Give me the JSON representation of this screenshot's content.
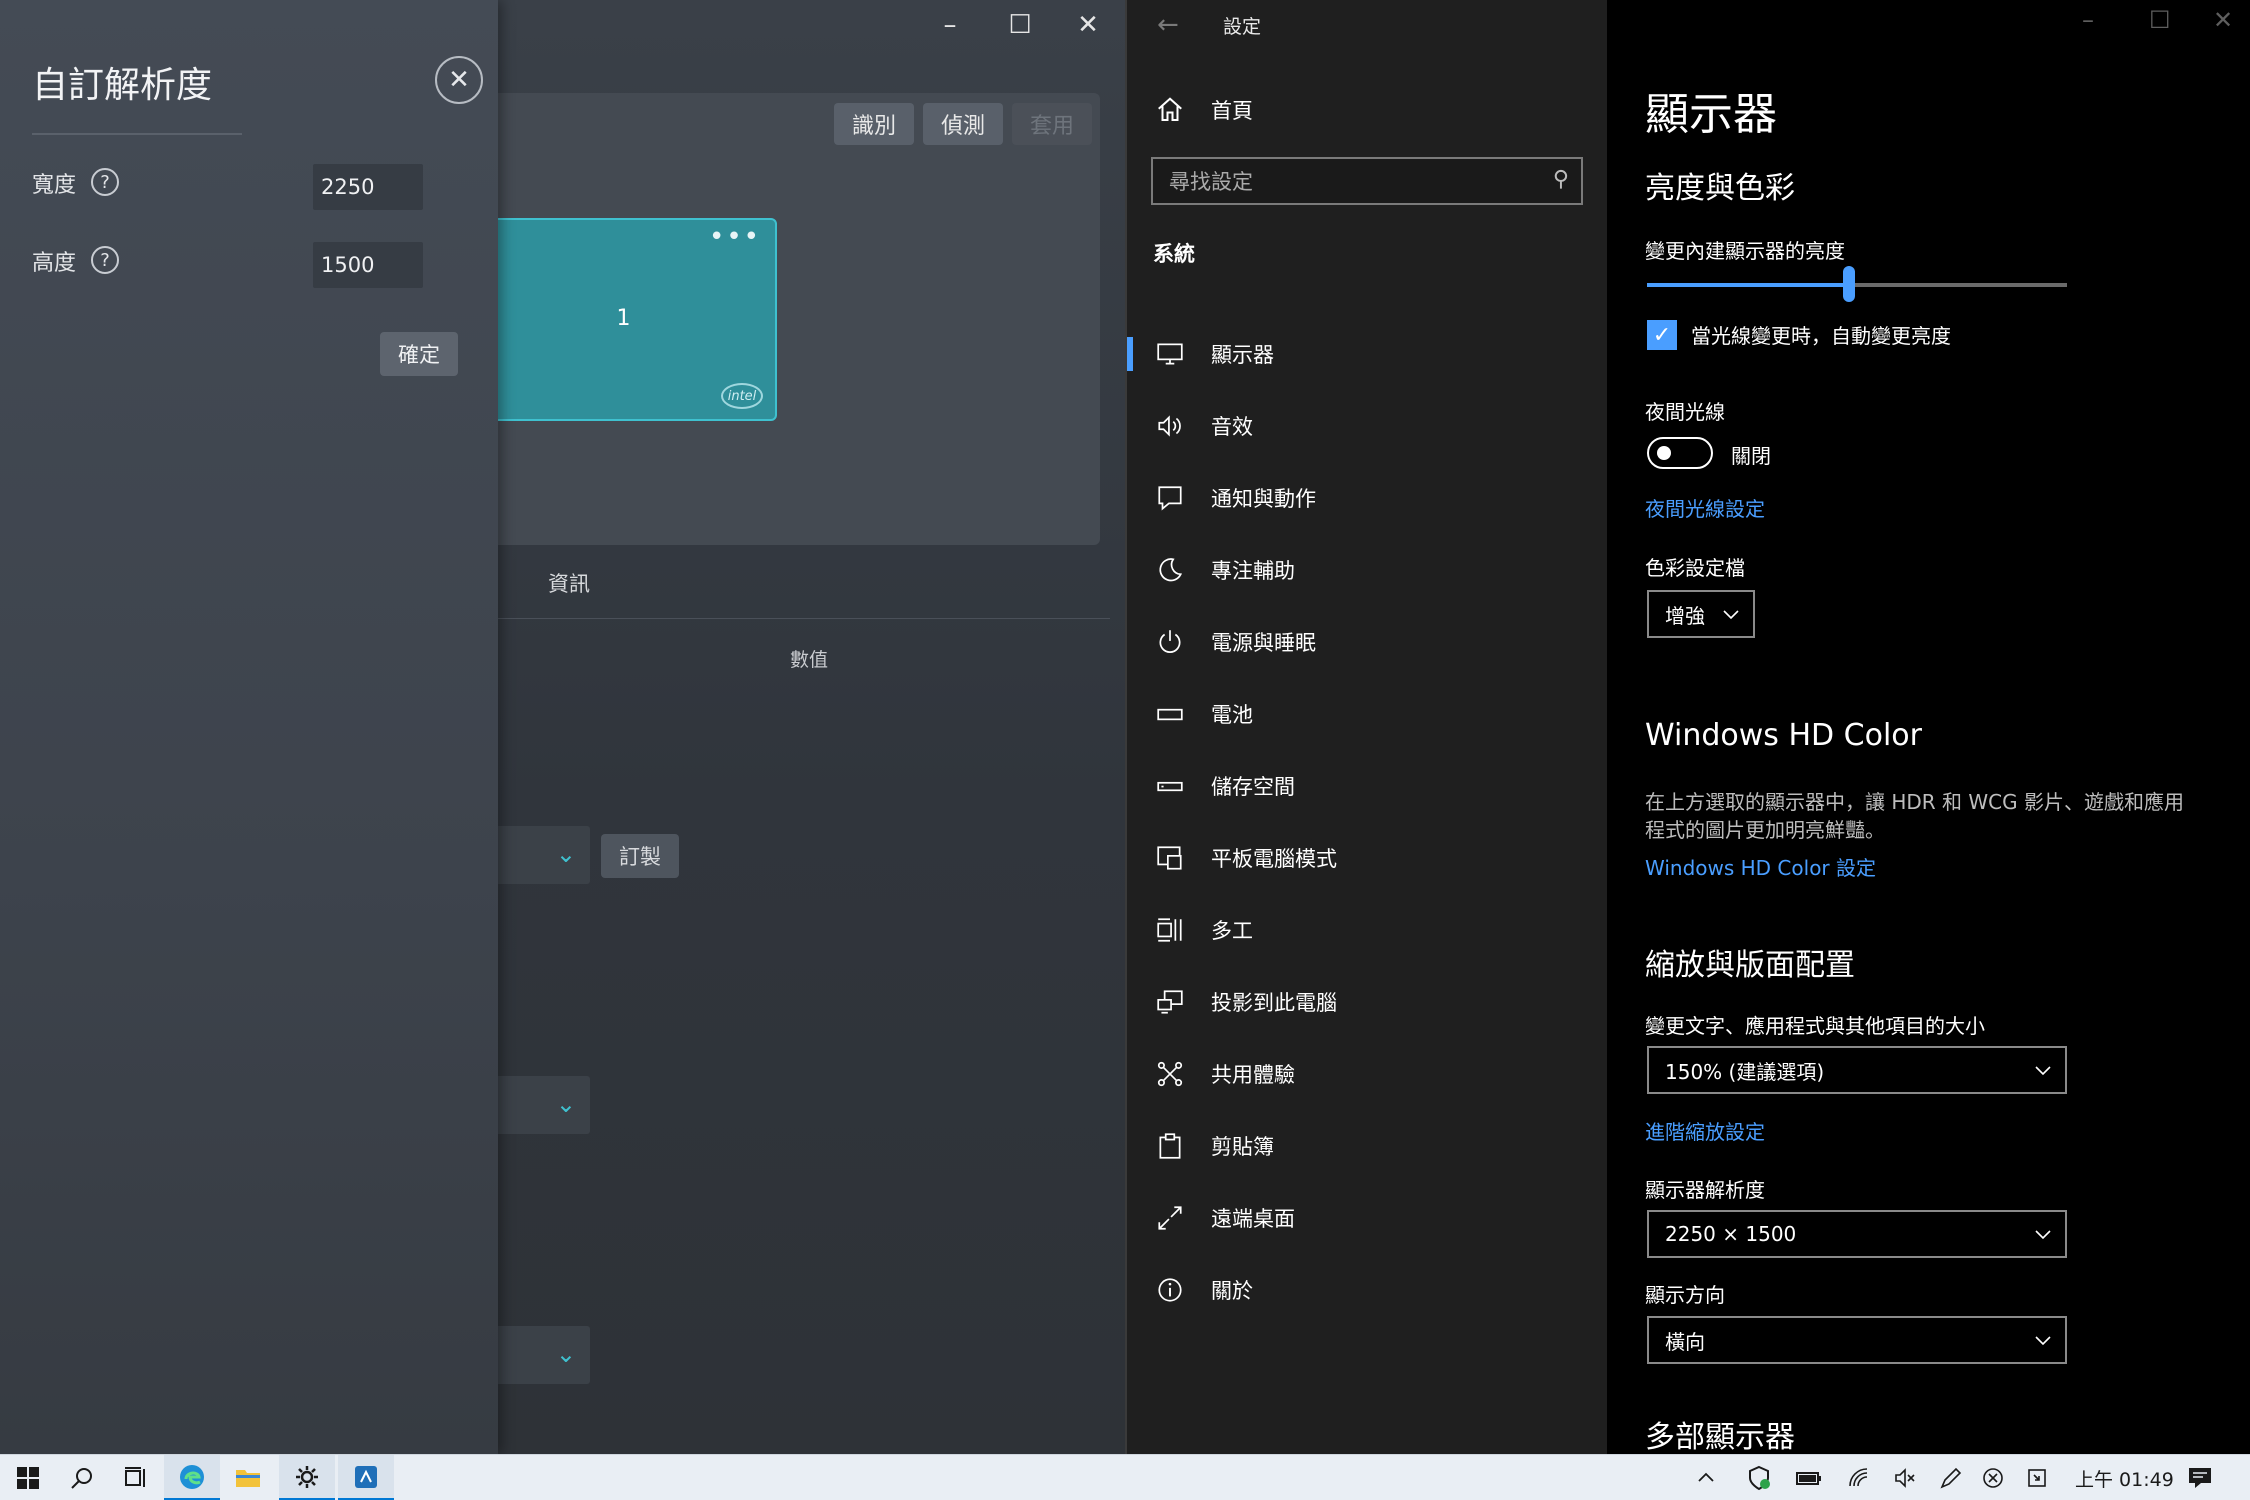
{
  "left_app": {
    "buttons": {
      "identify": "識別",
      "detect": "偵測",
      "apply": "套用"
    },
    "monitor": {
      "number": "1",
      "menu": "•••",
      "logo": "intel"
    },
    "info_tab": "資訊",
    "value_header": "數值",
    "custom_button": "訂製"
  },
  "flyout": {
    "title": "自訂解析度",
    "width_label": "寬度",
    "height_label": "高度",
    "width_value": "2250",
    "height_value": "1500",
    "confirm": "確定"
  },
  "settings": {
    "window_title": "設定",
    "home": "首頁",
    "search_placeholder": "尋找設定",
    "section": "系統",
    "nav_items": [
      {
        "label": "顯示器",
        "icon": "monitor-icon"
      },
      {
        "label": "音效",
        "icon": "speaker-icon"
      },
      {
        "label": "通知與動作",
        "icon": "notification-icon"
      },
      {
        "label": "專注輔助",
        "icon": "moon-icon"
      },
      {
        "label": "電源與睡眠",
        "icon": "power-icon"
      },
      {
        "label": "電池",
        "icon": "battery-icon"
      },
      {
        "label": "儲存空間",
        "icon": "storage-icon"
      },
      {
        "label": "平板電腦模式",
        "icon": "tablet-mode-icon"
      },
      {
        "label": "多工",
        "icon": "multitasking-icon"
      },
      {
        "label": "投影到此電腦",
        "icon": "project-icon"
      },
      {
        "label": "共用體驗",
        "icon": "shared-icon"
      },
      {
        "label": "剪貼簿",
        "icon": "clipboard-icon"
      },
      {
        "label": "遠端桌面",
        "icon": "remote-desktop-icon"
      },
      {
        "label": "關於",
        "icon": "info-icon"
      }
    ],
    "content": {
      "title": "顯示器",
      "brightness_heading": "亮度與色彩",
      "brightness_label": "變更內建顯示器的亮度",
      "brightness_level": 0.48,
      "auto_brightness": "當光線變更時，自動變更亮度",
      "night_light_label": "夜間光線",
      "night_light_state": "關閉",
      "night_light_link": "夜間光線設定",
      "color_profile_label": "色彩設定檔",
      "color_profile_value": "增強",
      "hd_heading": "Windows HD Color",
      "hd_desc_1": "在上方選取的顯示器中，讓 HDR 和 WCG 影片、遊戲和應用",
      "hd_desc_2": "程式的圖片更加明亮鮮豔。",
      "hd_link": "Windows HD Color 設定",
      "scale_heading": "縮放與版面配置",
      "scale_label": "變更文字、應用程式與其他項目的大小",
      "scale_value": "150% (建議選項)",
      "scale_link": "進階縮放設定",
      "resolution_label": "顯示器解析度",
      "resolution_value": "2250 × 1500",
      "orientation_label": "顯示方向",
      "orientation_value": "橫向",
      "multi_heading": "多部顯示器"
    }
  },
  "taskbar": {
    "time": "上午 01:49"
  },
  "colors": {
    "accent": "#4a9eff",
    "teal": "#3fc1cf"
  }
}
